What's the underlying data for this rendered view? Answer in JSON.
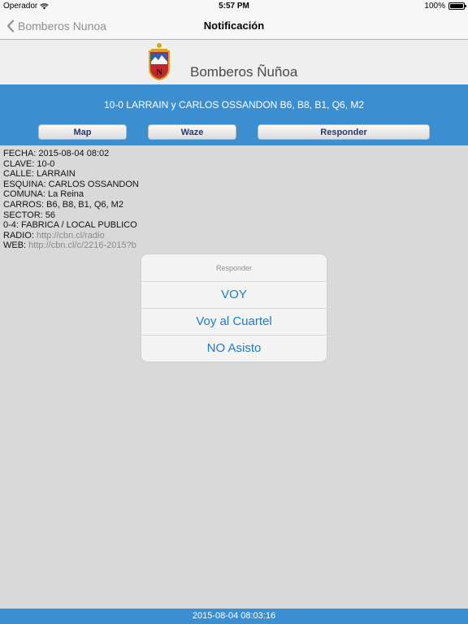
{
  "status_bar": {
    "carrier": "Operador",
    "time": "5:57 PM",
    "battery": "100%",
    "battery_level": 1.0
  },
  "nav": {
    "back_label": "Bomberos Nunoa",
    "title": "Notificación"
  },
  "brand": {
    "name": "Bomberos Ñuñoa",
    "logo_letter": "N"
  },
  "alert": {
    "title": "10-0 LARRAIN y CARLOS OSSANDON B6, B8, B1, Q6, M2",
    "buttons": {
      "map": "Map",
      "waze": "Waze",
      "responder": "Responder"
    }
  },
  "details": {
    "fecha": "FECHA: 2015-08-04 08:02",
    "clave": "CLAVE: 10-0",
    "calle": "CALLE: LARRAIN",
    "esquina": "ESQUINA: CARLOS OSSANDON",
    "comuna": "COMUNA: La Reina",
    "carros": "CARROS: B6, B8, B1, Q6, M2",
    "sector": "SECTOR: 56",
    "tipo": "0-4: FABRICA / LOCAL PUBLICO",
    "radio_label": "RADIO: ",
    "radio_url": "http://cbn.cl/radio",
    "web_label": "WEB: ",
    "web_url": "http://cbn.cl/c/2216-2015?b"
  },
  "action_sheet": {
    "title": "Responder",
    "options": [
      "VOY",
      "Voy al Cuartel",
      "NO Asisto"
    ]
  },
  "footer": {
    "timestamp": "2015-08-04 08:03:16"
  },
  "colors": {
    "accent_blue": "#3b8fd0",
    "action_text": "#1a7bd1",
    "logo_red": "#c0282d",
    "logo_gold": "#d9a520"
  }
}
